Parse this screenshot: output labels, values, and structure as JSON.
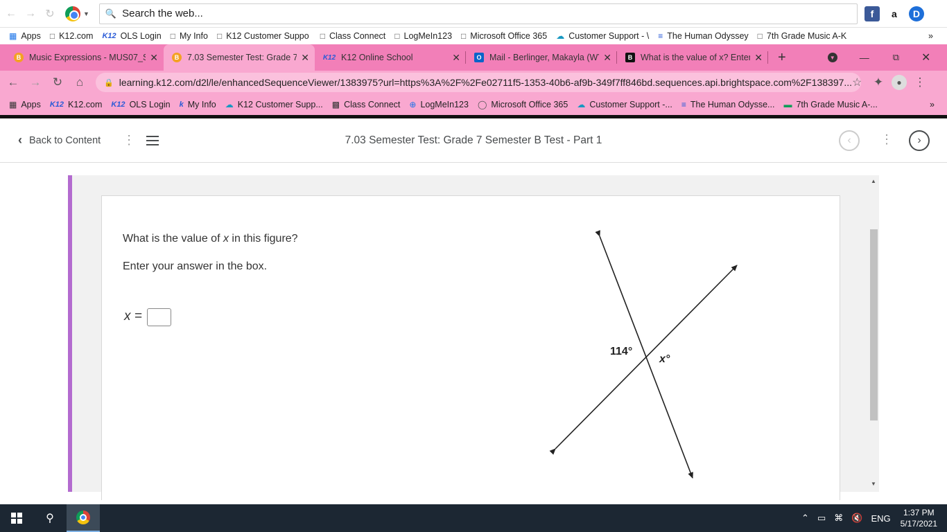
{
  "search_bar": {
    "placeholder": "Search the web..."
  },
  "bookmarks_top": [
    {
      "label": "Apps"
    },
    {
      "label": "K12.com"
    },
    {
      "label": "OLS Login"
    },
    {
      "label": "My Info"
    },
    {
      "label": "K12 Customer Suppo"
    },
    {
      "label": "Class Connect"
    },
    {
      "label": "LogMeIn123"
    },
    {
      "label": "Microsoft Office 365"
    },
    {
      "label": "Customer Support - \\"
    },
    {
      "label": "The Human Odyssey"
    },
    {
      "label": "7th Grade Music A-K"
    }
  ],
  "tabs": [
    {
      "label": "Music Expressions - MUS07_S",
      "icon": "brightspace-icon"
    },
    {
      "label": "7.03 Semester Test: Grade 7 S",
      "icon": "brightspace-icon"
    },
    {
      "label": "K12 Online School",
      "icon": "k12-icon"
    },
    {
      "label": "Mail - Berlinger, Makayla (WY",
      "icon": "outlook-icon"
    },
    {
      "label": "What is the value of x? Enter",
      "icon": "brainly-icon"
    }
  ],
  "address": {
    "url": "learning.k12.com/d2l/le/enhancedSequenceViewer/1383975?url=https%3A%2F%2Fe02711f5-1353-40b6-af9b-349f7ff846bd.sequences.api.brightspace.com%2F138397..."
  },
  "bookmarks_bar": [
    {
      "label": "Apps"
    },
    {
      "label": "K12.com"
    },
    {
      "label": "OLS Login"
    },
    {
      "label": "My Info"
    },
    {
      "label": "K12 Customer Supp..."
    },
    {
      "label": "Class Connect"
    },
    {
      "label": "LogMeIn123"
    },
    {
      "label": "Microsoft Office 365"
    },
    {
      "label": "Customer Support -..."
    },
    {
      "label": "The Human Odysse..."
    },
    {
      "label": "7th Grade Music A-..."
    }
  ],
  "header": {
    "back_label": "Back to Content",
    "title": "7.03 Semester Test: Grade 7 Semester B Test - Part 1"
  },
  "question": {
    "prompt_before": "What is the value of ",
    "prompt_var": "x",
    "prompt_after": " in this figure?",
    "instruction": "Enter your answer in the box.",
    "answer_label": "x =",
    "answer_value": "",
    "figure_angle_label": "114°",
    "figure_x_label": "x°"
  },
  "taskbar": {
    "language": "ENG",
    "time": "1:37 PM",
    "date": "5/17/2021"
  },
  "colors": {
    "theme_pink": "#f27fb8",
    "theme_pink_light": "#f9a8d0",
    "accent_purple": "#b36bcf"
  }
}
